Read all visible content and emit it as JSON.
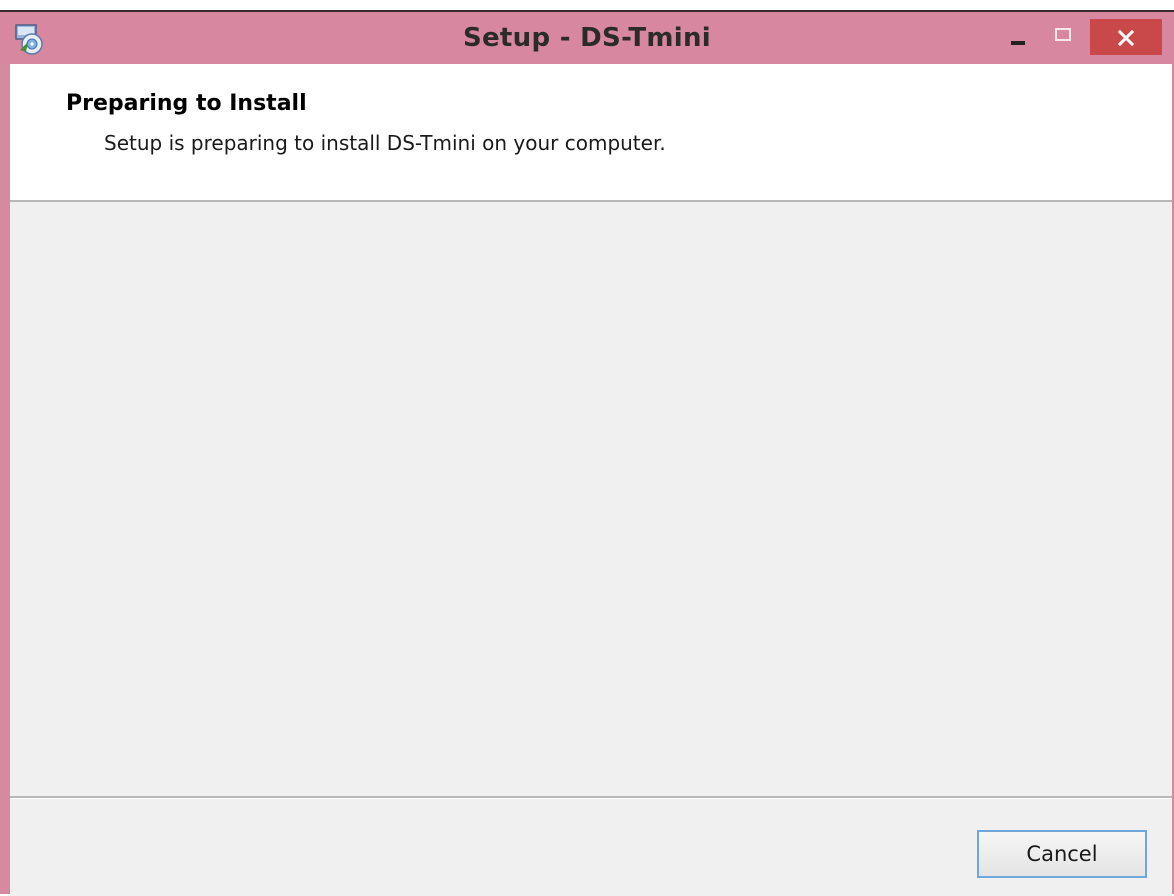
{
  "window": {
    "title": "Setup - DS-Tmini",
    "icon": "setup-disc-icon",
    "controls": {
      "minimize": "minimize-icon",
      "maximize": "maximize-icon",
      "close": "close-icon"
    }
  },
  "header": {
    "title": "Preparing to Install",
    "subtitle": "Setup is preparing to install DS-Tmini on your computer."
  },
  "footer": {
    "cancel_label": "Cancel"
  },
  "colors": {
    "titlebar": "#d7879f",
    "close_button": "#c9494a",
    "panel": "#f0f0f0",
    "button_focus_border": "#6fa7da"
  }
}
